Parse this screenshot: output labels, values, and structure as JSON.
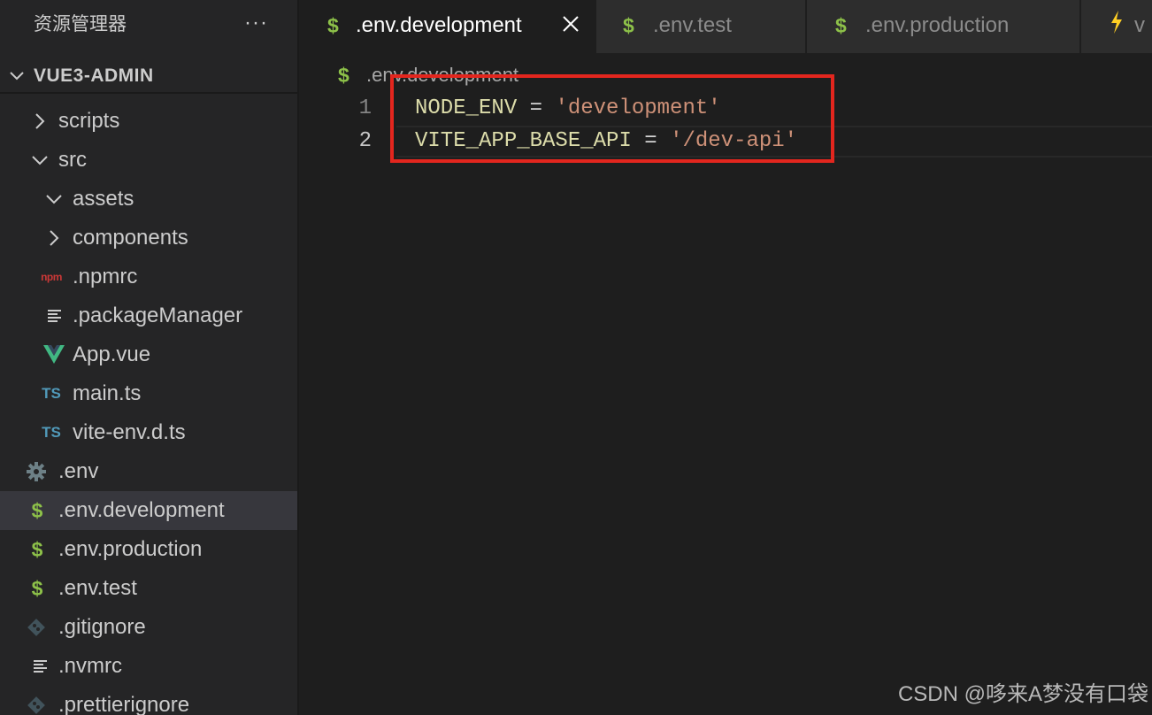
{
  "explorer": {
    "title": "资源管理器",
    "more": "···",
    "root_label": "VUE3-ADMIN",
    "items": [
      {
        "label": "scripts",
        "type": "folder",
        "expanded": false
      },
      {
        "label": "src",
        "type": "folder",
        "expanded": true
      },
      {
        "label": "assets",
        "type": "folder",
        "expanded": true
      },
      {
        "label": "components",
        "type": "folder",
        "expanded": false
      },
      {
        "label": ".npmrc",
        "type": "file",
        "icon": "npm-icon"
      },
      {
        "label": ".packageManager",
        "type": "file",
        "icon": "text-file-icon"
      },
      {
        "label": "App.vue",
        "type": "file",
        "icon": "vue-icon"
      },
      {
        "label": "main.ts",
        "type": "file",
        "icon": "typescript-icon"
      },
      {
        "label": "vite-env.d.ts",
        "type": "file",
        "icon": "typescript-icon"
      },
      {
        "label": ".env",
        "type": "file",
        "icon": "gear-icon"
      },
      {
        "label": ".env.development",
        "type": "file",
        "icon": "dollar-icon",
        "selected": true
      },
      {
        "label": ".env.production",
        "type": "file",
        "icon": "dollar-icon"
      },
      {
        "label": ".env.test",
        "type": "file",
        "icon": "dollar-icon"
      },
      {
        "label": ".gitignore",
        "type": "file",
        "icon": "git-icon"
      },
      {
        "label": ".nvmrc",
        "type": "file",
        "icon": "text-file-icon"
      },
      {
        "label": ".prettierignore",
        "type": "file",
        "icon": "git-icon"
      }
    ]
  },
  "tabs": [
    {
      "label": ".env.development",
      "icon": "dollar-icon",
      "active": true
    },
    {
      "label": ".env.test",
      "icon": "dollar-icon",
      "active": false
    },
    {
      "label": ".env.production",
      "icon": "dollar-icon",
      "active": false
    },
    {
      "label": "v",
      "icon": "vite-icon",
      "active": false
    }
  ],
  "editor": {
    "breadcrumb": ".env.development",
    "lines": [
      {
        "number": "1",
        "key": "NODE_ENV",
        "op": " = ",
        "value": "'development'"
      },
      {
        "number": "2",
        "key": "VITE_APP_BASE_API",
        "op": " = ",
        "value": "'/dev-api'"
      }
    ]
  },
  "watermark": "CSDN @哆来A梦没有口袋",
  "icons": {
    "dollar": "$",
    "ts": "TS",
    "npm": "npm"
  },
  "colors": {
    "highlight_box": "#e3261e",
    "env_icon": "#8dc149",
    "ts_icon": "#519aba",
    "vue_icon": "#41b883",
    "npm_icon": "#cb3837",
    "code_key": "#dcdcaa",
    "code_string": "#ce9178"
  }
}
